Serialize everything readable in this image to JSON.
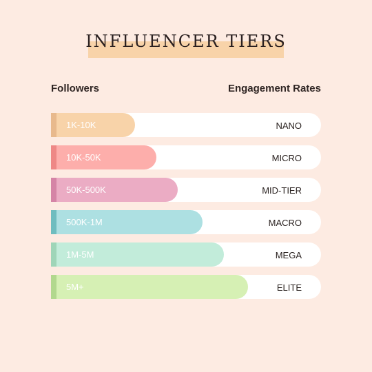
{
  "title": "INFLUENCER TIERS",
  "headers": {
    "left": "Followers",
    "right": "Engagement Rates"
  },
  "chart_data": {
    "type": "bar",
    "orientation": "horizontal",
    "title": "INFLUENCER TIERS",
    "xlabel": "Followers",
    "ylabel": "Engagement Rates",
    "categories": [
      "1K-10K",
      "10K-50K",
      "50K-500K",
      "500K-1M",
      "1M-5M",
      "5M+"
    ],
    "tiers": [
      "NANO",
      "MICRO",
      "MID-TIER",
      "MACRO",
      "MEGA",
      "ELITE"
    ],
    "values": [
      0.31,
      0.39,
      0.47,
      0.56,
      0.64,
      0.73
    ],
    "colors": [
      "#f8d3a9",
      "#fdaeab",
      "#ebacc4",
      "#ade0e2",
      "#c2ecda",
      "#d6f0b4"
    ],
    "edge_colors": [
      "#e8b98d",
      "#ee8886",
      "#d584a6",
      "#6fbdbf",
      "#9fd5b8",
      "#b2d88e"
    ]
  }
}
